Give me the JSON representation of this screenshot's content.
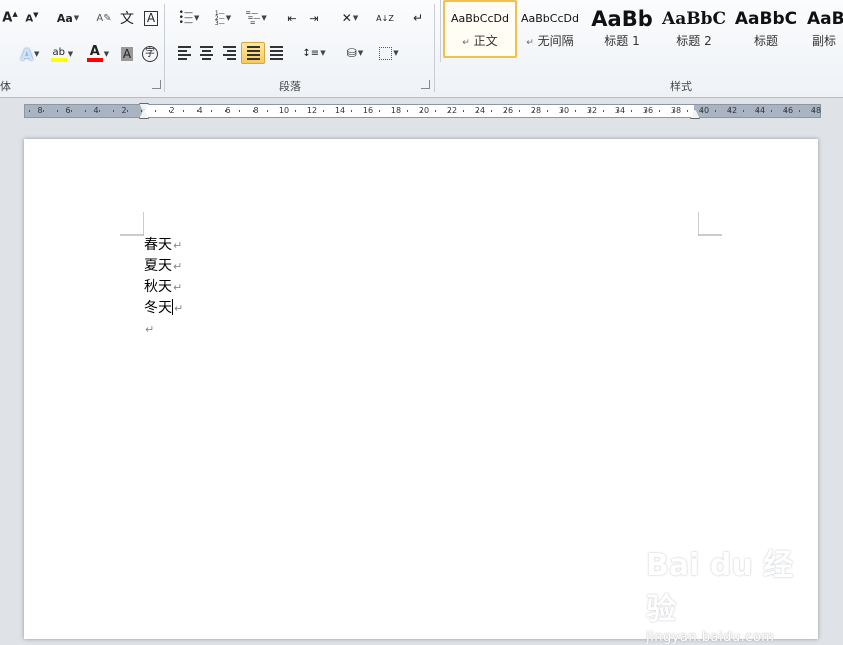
{
  "ribbon": {
    "groups": {
      "font_label": "体",
      "paragraph_label": "段落",
      "styles_label": "样式"
    },
    "font": {
      "grow_font_glyph": "A",
      "shrink_font_glyph": "A",
      "change_case_label": "Aa",
      "phonetic_guide_glyph": "文",
      "enclose_char_glyph": "A",
      "text_effects_glyph": "A",
      "highlight_glyph": "ab",
      "font_color_glyph": "A",
      "char_shading_glyph": "A",
      "enclosed_char_glyph": "字",
      "highlight_color": "#ffff00",
      "font_color": "#ff0000"
    },
    "paragraph": {
      "sort_glyph": "A↓Z",
      "show_marks_glyph": "↵"
    },
    "styles": [
      {
        "preview": "AaBbCcDd",
        "name": "正文",
        "mark": "↵",
        "selected": true
      },
      {
        "preview": "AaBbCcDd",
        "name": "无间隔",
        "mark": "↵",
        "selected": false
      },
      {
        "preview": "AaBb",
        "name": "标题 1",
        "mark": "",
        "selected": false
      },
      {
        "preview": "AaBbC",
        "name": "标题 2",
        "mark": "",
        "selected": false
      },
      {
        "preview": "AaBbC",
        "name": "标题",
        "mark": "",
        "selected": false
      },
      {
        "preview": "AaB",
        "name": "副标",
        "mark": "",
        "selected": false
      }
    ]
  },
  "ruler": {
    "left_numbers": [
      "8",
      "6",
      "4",
      "2"
    ],
    "right_numbers": [
      "2",
      "4",
      "6",
      "8",
      "10",
      "12",
      "14",
      "16",
      "18",
      "20",
      "22",
      "24",
      "26",
      "28",
      "30",
      "32",
      "34",
      "36",
      "38",
      "40",
      "42",
      "44",
      "46",
      "48"
    ]
  },
  "document": {
    "lines": [
      "春天",
      "夏天",
      "秋天",
      "冬天",
      ""
    ],
    "paragraph_mark": "↵",
    "cursor_line": 3
  },
  "watermark": {
    "logo_text": "Bai du 经验",
    "url": "jingyan.baidu.com"
  },
  "colors": {
    "accent": "#f2c04c",
    "ribbon_bg": "#eef2f6",
    "workspace_bg": "#dfe3e8"
  }
}
